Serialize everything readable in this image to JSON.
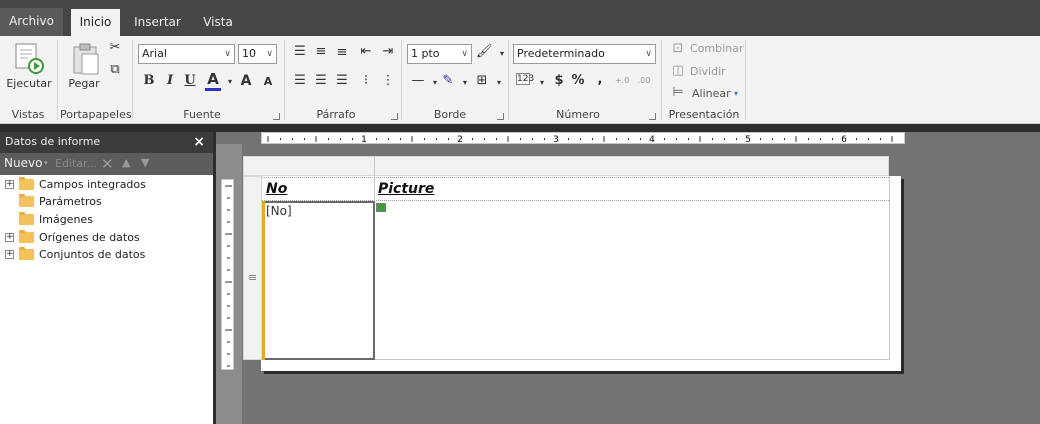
{
  "tabs": [
    {
      "label": "Archivo"
    },
    {
      "label": "Inicio"
    },
    {
      "label": "Insertar"
    },
    {
      "label": "Vista"
    }
  ],
  "ribbon": {
    "vistas": {
      "run_label": "Ejecutar",
      "group": "Vistas"
    },
    "portapapeles": {
      "paste_label": "Pegar",
      "group": "Portapapeles"
    },
    "fuente": {
      "font_name": "Arial",
      "font_size": "10",
      "group": "Fuente",
      "bold": "B",
      "italic": "I",
      "underline": "U",
      "font_color": "A",
      "grow": "A",
      "shrink": "A"
    },
    "parrafo": {
      "group": "Párrafo"
    },
    "borde": {
      "border_width": "1 pto",
      "group": "Borde"
    },
    "numero": {
      "format": "Predeterminado",
      "group": "Número",
      "currency": "$",
      "percent": "%",
      "comma": ","
    },
    "presentacion": {
      "merge": "Combinar",
      "split": "Dividir",
      "align": "Alinear",
      "group": "Presentación"
    }
  },
  "panel": {
    "title": "Datos de informe",
    "close": "×",
    "tools": {
      "new": "Nuevo",
      "edit": "Editar..."
    },
    "tree": [
      {
        "label": "Campos integrados",
        "expandable": true
      },
      {
        "label": "Parámetros",
        "expandable": false
      },
      {
        "label": "Imágenes",
        "expandable": false
      },
      {
        "label": "Orígenes de datos",
        "expandable": true
      },
      {
        "label": "Conjuntos de datos",
        "expandable": true
      }
    ]
  },
  "ruler": {
    "marks": [
      "1",
      "2",
      "3",
      "4",
      "5",
      "6"
    ]
  },
  "report": {
    "headers": [
      "No",
      "Picture"
    ],
    "field": "[No]",
    "row_handle": "≡"
  },
  "colors": {
    "accent_orange": "#e6a92a",
    "dark_bg": "#464646",
    "ribbon_bg": "#f3f3f3"
  }
}
